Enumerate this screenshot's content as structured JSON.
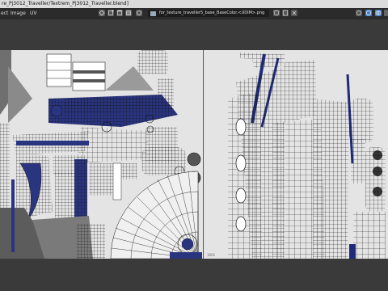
{
  "window": {
    "title": "re_Pj3012_Traveller/Textrem_Pj3012_Traveller.blend]"
  },
  "menu": {
    "items": [
      "ect",
      "Image",
      "UV"
    ]
  },
  "toolbar": {
    "image_name": "for_texture_traveller5_base_BaseColor.<UDIM>.png"
  },
  "canvas": {
    "tile_label": "1001"
  },
  "colors": {
    "uv_background": "#e4e4e4",
    "mesh_line": "#111111",
    "accent_blue": "#1f2a78",
    "header": "#2b2b2b",
    "panel": "#3a3a3a"
  }
}
